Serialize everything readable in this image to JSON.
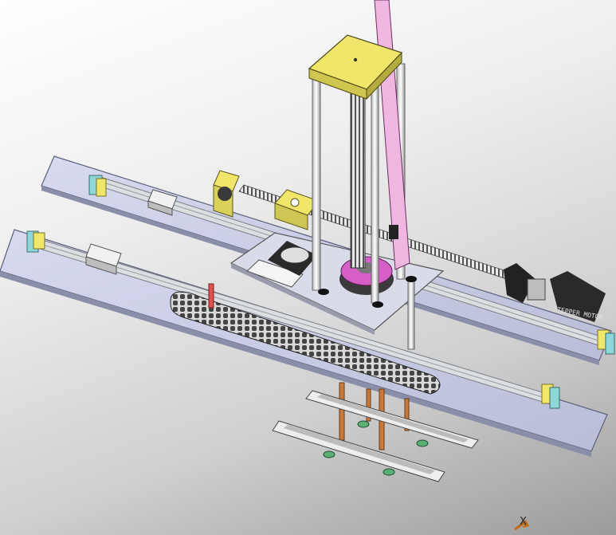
{
  "viewport": {
    "background_top": "#ffffff",
    "background_bottom": "#9b9b9b"
  },
  "colors": {
    "plate": "#c9cde3",
    "plate_edge": "#6a6e86",
    "rail": "#d7d9dc",
    "yellow": "#efe66a",
    "pink": "#f0b6e2",
    "magenta": "#d65fc6",
    "teal": "#8ed7d8",
    "copper": "#c97a3a",
    "motor": "#2a2a2a",
    "chain": "#3a3a3a"
  },
  "icons": {
    "motor_label": "motor-label-icon",
    "triad": "coordinate-triad-icon"
  },
  "motor": {
    "label": "STEPPER MOTOR"
  },
  "triad": {
    "axis_label": "X"
  }
}
